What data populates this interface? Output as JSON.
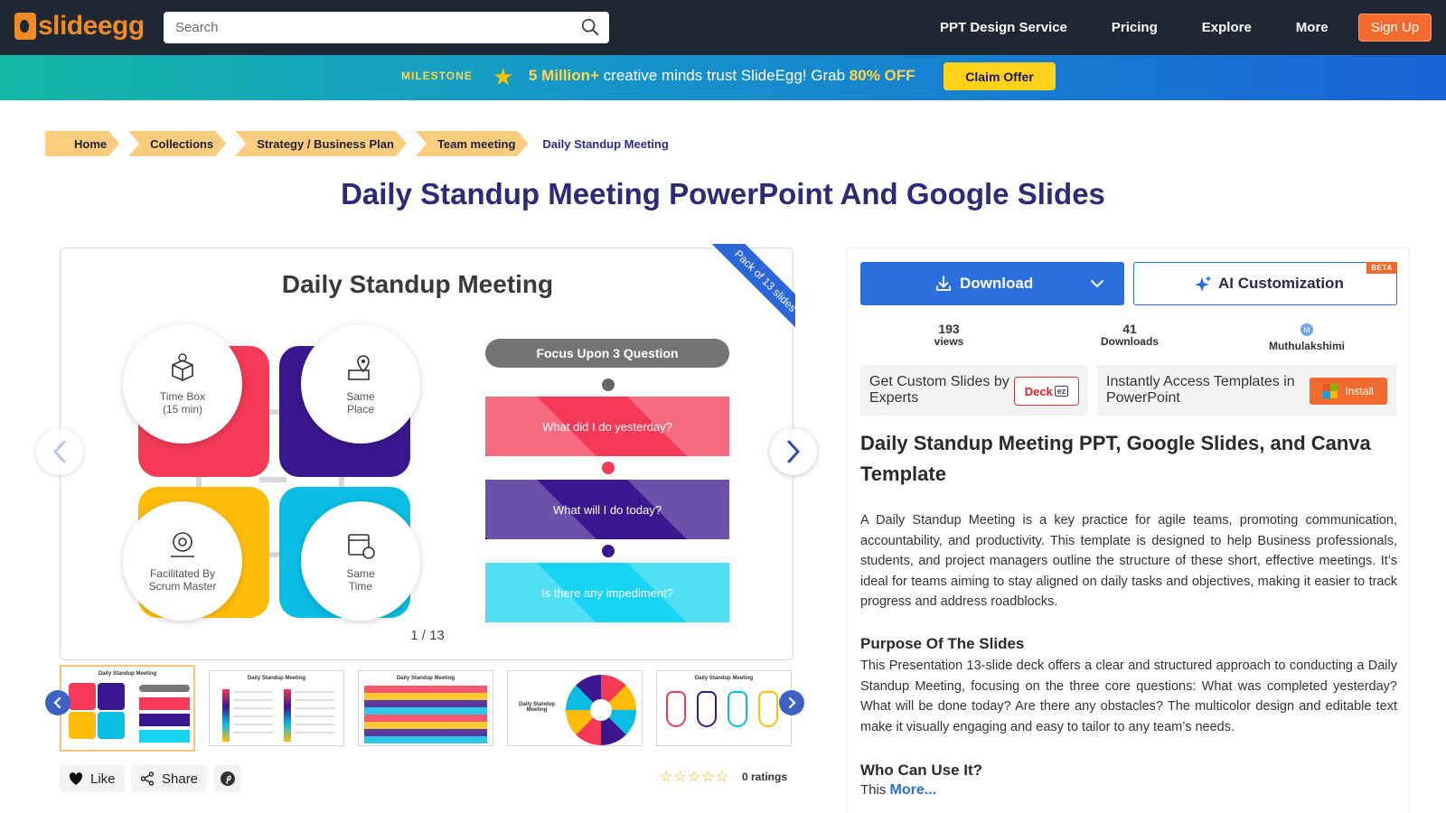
{
  "header": {
    "logo_text": "slideegg",
    "search_placeholder": "Search",
    "nav": [
      "PPT Design Service",
      "Pricing",
      "Explore",
      "More"
    ],
    "signup_label": "Sign Up"
  },
  "promo": {
    "milestone": "MILESTONE",
    "highlight": "5 Million+",
    "text_mid": " creative minds trust SlideEgg! Grab ",
    "discount": "80% OFF",
    "claim_label": "Claim Offer"
  },
  "breadcrumb": [
    "Home",
    "Collections",
    "Strategy / Business Plan",
    "Team meeting",
    "Daily Standup Meeting"
  ],
  "page_title": "Daily Standup Meeting PowerPoint And Google Slides",
  "preview": {
    "ribbon": "Pack of 13 slides",
    "slide_title": "Daily Standup Meeting",
    "circles": [
      {
        "label": "Time Box (15 min)"
      },
      {
        "label": "Same Place"
      },
      {
        "label": "Facilitated By Scrum Master"
      },
      {
        "label": "Same Time"
      }
    ],
    "focus_label": "Focus Upon 3 Question",
    "questions": [
      "What did I do yesterday?",
      "What will I do today?",
      "Is there any impediment?"
    ],
    "counter": "1 / 13"
  },
  "thumbnails": [
    {
      "title": "Daily Standup Meeting"
    },
    {
      "title": "Daily Standup Meeting"
    },
    {
      "title": "Daily Standup Meeting"
    },
    {
      "title": "Daily Standup Meeting"
    },
    {
      "title": "Daily Standup Meeting"
    }
  ],
  "actions": {
    "like_label": "Like",
    "share_label": "Share",
    "ratings_label": "0 ratings",
    "star_count": 5,
    "rating_value": 0
  },
  "panel": {
    "download_label": "Download",
    "ai_label": "AI Customization",
    "beta_label": "BETA",
    "views_count": "193",
    "views_label": "views",
    "downloads_count": "41",
    "downloads_label": "Downloads",
    "author_initial": "M",
    "author": "Muthulakshimi",
    "custom_slides_text": "Get Custom Slides by Experts",
    "deck_label": "Deck",
    "deck_badge": "ez",
    "access_text": "Instantly Access Templates in PowerPoint",
    "install_label": "Install",
    "desc_title": "Daily Standup Meeting PPT, Google Slides, and Canva Template",
    "desc_para": "A Daily Standup Meeting is a key practice for agile teams, promoting communication, accountability, and productivity. This template is designed to help Business professionals, students, and project managers outline the structure of these short, effective meetings. It’s ideal for teams aiming to stay aligned on daily tasks and objectives, making it easier to track progress and address roadblocks.",
    "purpose_heading": "Purpose Of The Slides",
    "purpose_para": "This Presentation 13-slide deck offers a clear and structured approach to conducting a Daily Standup Meeting, focusing on the three core questions: What was completed yesterday? What will be done today? Are there any obstacles? The multicolor design and editable text make it visually engaging and easy to tailor to any team’s needs.",
    "who_heading": "Who Can Use It?",
    "who_prefix": "This",
    "more_link": "More..."
  },
  "colors": {
    "nav_bg": "#1f2733",
    "brand_orange": "#f08a24",
    "primary_blue": "#2a6fdb",
    "title_navy": "#2d2a7a",
    "slide_red": "#f43a56",
    "slide_purple": "#3b178f",
    "slide_yellow": "#ffbd0a",
    "slide_cyan": "#09bde3"
  }
}
